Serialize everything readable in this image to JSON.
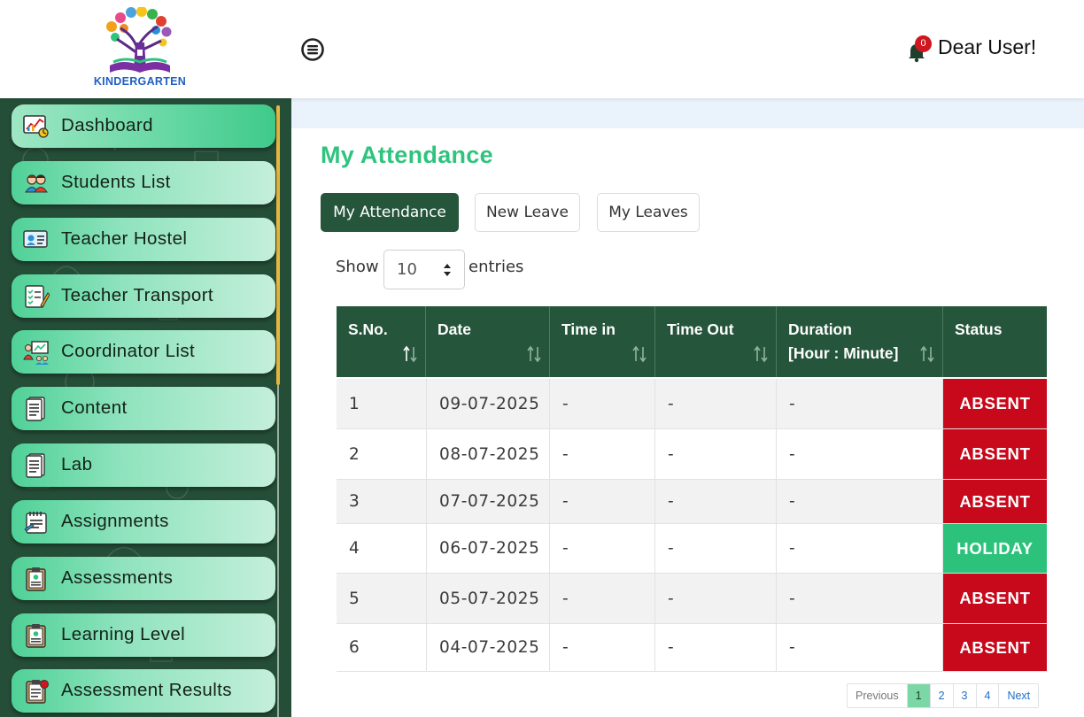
{
  "header": {
    "logo_text": "KINDERGARTEN",
    "notification_count": "0",
    "user_greeting": "Dear User!"
  },
  "sidebar": {
    "items": [
      {
        "label": "Dashboard",
        "icon": "dashboard-chart-icon",
        "active": true
      },
      {
        "label": "Students List",
        "icon": "students-icon"
      },
      {
        "label": "Teacher Hostel",
        "icon": "id-card-icon"
      },
      {
        "label": "Teacher Transport",
        "icon": "checklist-icon"
      },
      {
        "label": "Coordinator List",
        "icon": "presentation-icon"
      },
      {
        "label": "Content",
        "icon": "document-icon"
      },
      {
        "label": "Lab",
        "icon": "document-icon"
      },
      {
        "label": "Assignments",
        "icon": "notepad-icon"
      },
      {
        "label": "Assessments",
        "icon": "clipboard-icon"
      },
      {
        "label": "Learning Level",
        "icon": "clipboard-icon"
      },
      {
        "label": "Assessment Results",
        "icon": "result-clipboard-icon"
      }
    ]
  },
  "main": {
    "title": "My Attendance",
    "tabs": [
      {
        "label": "My Attendance",
        "active": true
      },
      {
        "label": "New Leave"
      },
      {
        "label": "My Leaves"
      }
    ],
    "length": {
      "show_label": "Show",
      "selected": "10",
      "entries_label": "entries"
    },
    "table": {
      "headers": [
        "S.No.",
        "Date",
        "Time in",
        "Time Out",
        "Duration [Hour : Minute]",
        "Status"
      ],
      "headers_lines": [
        [
          "S.No."
        ],
        [
          "Date"
        ],
        [
          "Time in"
        ],
        [
          "Time Out"
        ],
        [
          "Duration",
          "[Hour : Minute]"
        ],
        [
          "Status"
        ]
      ],
      "rows": [
        {
          "sno": "1",
          "date": "09-07-2025",
          "time_in": "-",
          "time_out": "-",
          "duration": "-",
          "status": "ABSENT"
        },
        {
          "sno": "2",
          "date": "08-07-2025",
          "time_in": "-",
          "time_out": "-",
          "duration": "-",
          "status": "ABSENT"
        },
        {
          "sno": "3",
          "date": "07-07-2025",
          "time_in": "-",
          "time_out": "-",
          "duration": "-",
          "status": "ABSENT"
        },
        {
          "sno": "4",
          "date": "06-07-2025",
          "time_in": "-",
          "time_out": "-",
          "duration": "-",
          "status": "HOLIDAY"
        },
        {
          "sno": "5",
          "date": "05-07-2025",
          "time_in": "-",
          "time_out": "-",
          "duration": "-",
          "status": "ABSENT"
        },
        {
          "sno": "6",
          "date": "04-07-2025",
          "time_in": "-",
          "time_out": "-",
          "duration": "-",
          "status": "ABSENT"
        }
      ]
    },
    "pagination": {
      "previous": "Previous",
      "pages": [
        "1",
        "2",
        "3",
        "4"
      ],
      "current": "1",
      "next": "Next"
    }
  },
  "colors": {
    "primary_green": "#25553b",
    "title_green": "#2fc47e",
    "absent_red": "#c8081b",
    "holiday_green": "#2cc27c",
    "sidebar_bg": "#254e38"
  }
}
